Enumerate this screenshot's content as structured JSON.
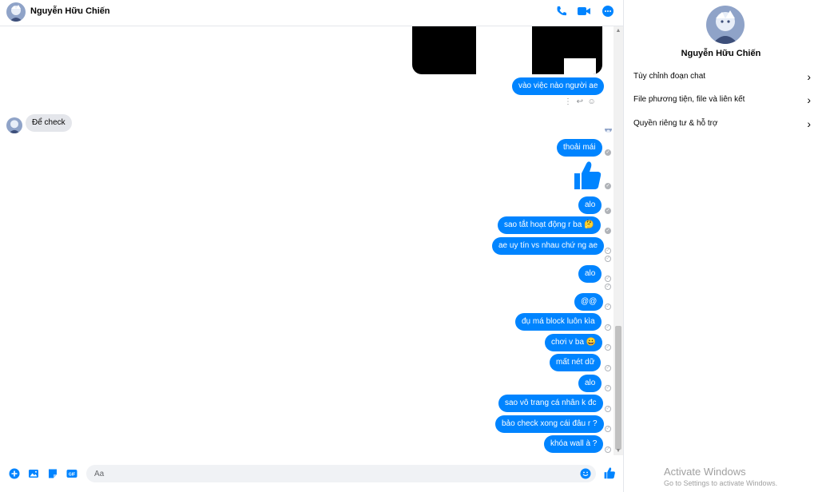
{
  "contact": {
    "name": "Nguyễn Hữu Chiến"
  },
  "header": {
    "icons": [
      "phone-icon",
      "video-icon",
      "more-icon"
    ],
    "accent": "#0084ff"
  },
  "messages": {
    "shared_image": "screenshot",
    "outgoing_first": "vào việc nào người ae",
    "incoming": "Để check",
    "outgoing": [
      "thoải mái",
      "alo",
      "sao tắt hoạt động r ba 🤔",
      "ae uy tín vs nhau chứ ng ae",
      "alo",
      "@@",
      "đụ má block luôn kìa",
      "chơi v ba 😀",
      "mất nét dữ",
      "alo",
      "sao vô trang cá nhân k đc",
      "bảo check xong cái đâu r ?",
      "khóa wall à ?"
    ],
    "like_emoji": "👍"
  },
  "composer": {
    "placeholder": "Aa"
  },
  "sidebar": {
    "items": [
      {
        "label": "Tùy chỉnh đoạn chat"
      },
      {
        "label": "File phương tiện, file và liên kết"
      },
      {
        "label": "Quyền riêng tư & hỗ trợ"
      }
    ]
  },
  "watermark": {
    "line1": "Activate Windows",
    "line2": "Go to Settings to activate Windows."
  }
}
